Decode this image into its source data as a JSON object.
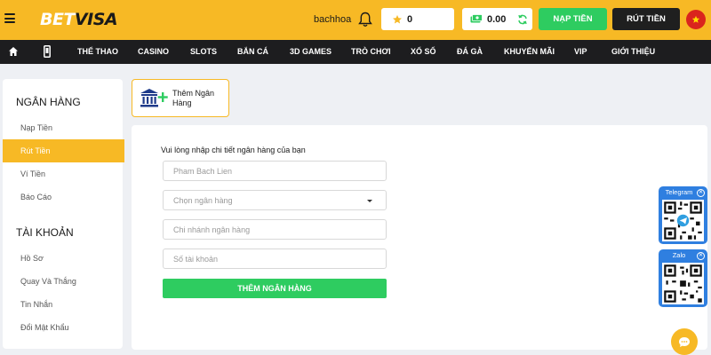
{
  "header": {
    "logo_bet": "BET",
    "logo_visa": "VISA",
    "username": "bachhoa",
    "points_balance": "0",
    "cash_balance": "0.00",
    "deposit_label": "NẠP TIỀN",
    "withdraw_label": "RÚT TIỀN",
    "brand_color": "#f7b925"
  },
  "nav": {
    "items": [
      "THỂ THAO",
      "CASINO",
      "SLOTS",
      "BẮN CÁ",
      "3D GAMES",
      "TRÒ CHƠI",
      "XỔ SỐ",
      "ĐÁ GÀ",
      "KHUYẾN MÃI",
      "VIP",
      "GIỚI THIỆU"
    ],
    "icons": [
      "home-icon",
      "mobile-icon"
    ]
  },
  "sidebar": {
    "bank_heading": "NGÂN HÀNG",
    "bank_items": [
      "Nạp Tiền",
      "Rút Tiền",
      "Ví Tiền",
      "Báo Cáo"
    ],
    "active_item": "Rút Tiền",
    "account_heading": "TÀI KHOẢN",
    "account_items": [
      "Hồ Sơ",
      "Quay Và Thắng",
      "Tin Nhắn",
      "Đổi Mật Khẩu"
    ]
  },
  "add_bank": {
    "label_line1": "Thêm Ngân",
    "label_line2": "Hàng"
  },
  "form": {
    "title": "Vui lòng nhập chi tiết ngân hàng của bạn",
    "name_placeholder": "Pham Bach Lien",
    "bank_select_label": "Chọn ngân hàng",
    "branch_placeholder": "Chi nhánh ngân hàng",
    "account_placeholder": "Số tài khoản",
    "submit_label": "THÊM NGÂN HÀNG",
    "submit_color": "#2ecc60"
  },
  "widgets": {
    "telegram_label": "Telegram",
    "zalo_label": "Zalo",
    "qr_color": "#2f7fe0"
  }
}
